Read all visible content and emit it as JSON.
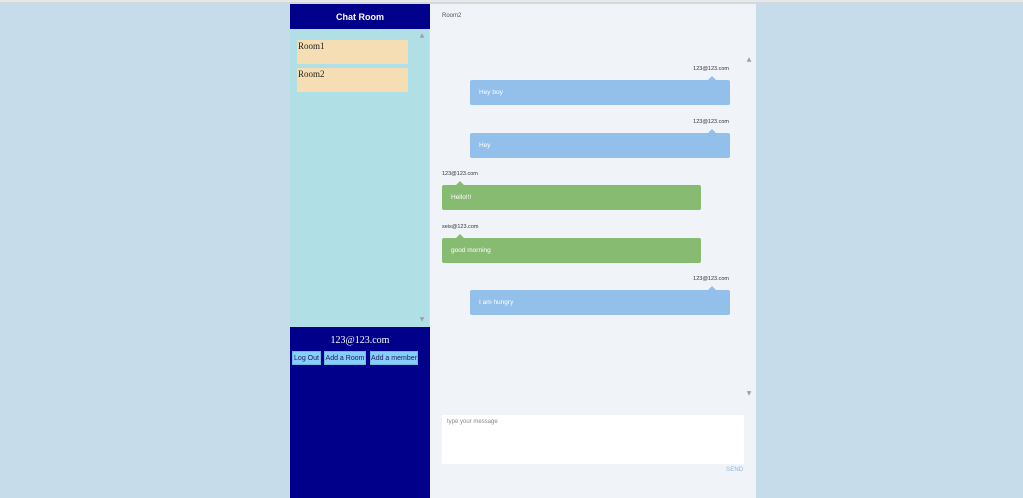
{
  "sidebar": {
    "title": "Chat Room",
    "rooms": [
      {
        "label": "Room1"
      },
      {
        "label": "Room2"
      }
    ],
    "scroll_up": "▲",
    "scroll_down": "▼"
  },
  "user_panel": {
    "email": "123@123.com",
    "buttons": {
      "logout": "Log Out",
      "add_room": "Add a Room",
      "add_member": "Add a member"
    }
  },
  "chat": {
    "room_title": "Room2",
    "messages": [
      {
        "sender": "123@123.com",
        "text": "Hey boy",
        "mine": true
      },
      {
        "sender": "123@123.com",
        "text": "Hey",
        "mine": true
      },
      {
        "sender": "123@123.com",
        "text": "Hello!!!",
        "mine": false
      },
      {
        "sender": "seis@123.com",
        "text": "good morning",
        "mine": false
      },
      {
        "sender": "123@123.com",
        "text": "I am hungry",
        "mine": true
      }
    ],
    "composer_placeholder": "type your message",
    "send_label": "SEND",
    "scroll_up": "▲",
    "scroll_down": "▼"
  },
  "colors": {
    "page_bg": "#c6dcea",
    "sidebar_header": "#00008b",
    "room_list_bg": "#b0e0e6",
    "room_item_bg": "#f5deb3",
    "user_panel_bg": "#00008b",
    "action_button_bg": "#87cefa",
    "my_bubble": "#93bfeb",
    "their_bubble": "#88bb72",
    "chat_bg": "#f0f4f8"
  }
}
